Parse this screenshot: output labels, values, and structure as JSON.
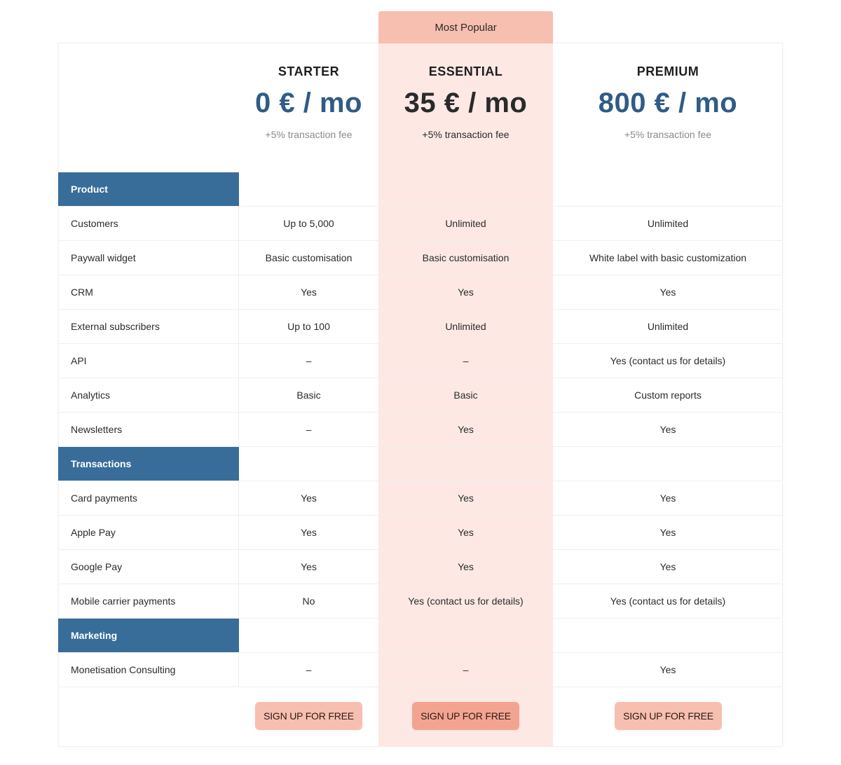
{
  "badge": {
    "label": "Most Popular"
  },
  "plans": [
    {
      "name": "STARTER",
      "price": "0 € / mo",
      "fee": "+5% transaction fee",
      "cta": "SIGN UP FOR FREE"
    },
    {
      "name": "ESSENTIAL",
      "price": "35 € / mo",
      "fee": "+5% transaction fee",
      "cta": "SIGN UP FOR FREE"
    },
    {
      "name": "PREMIUM",
      "price": "800 € / mo",
      "fee": "+5% transaction fee",
      "cta": "SIGN UP FOR FREE"
    }
  ],
  "sections": [
    {
      "title": "Product",
      "rows": [
        {
          "feature": "Customers",
          "values": [
            "Up to 5,000",
            "Unlimited",
            "Unlimited"
          ]
        },
        {
          "feature": "Paywall widget",
          "values": [
            "Basic customisation",
            "Basic customisation",
            "White label with basic customization"
          ]
        },
        {
          "feature": "CRM",
          "values": [
            "Yes",
            "Yes",
            "Yes"
          ]
        },
        {
          "feature": "External subscribers",
          "values": [
            "Up to 100",
            "Unlimited",
            "Unlimited"
          ]
        },
        {
          "feature": "API",
          "values": [
            "–",
            "–",
            "Yes (contact us for details)"
          ]
        },
        {
          "feature": "Analytics",
          "values": [
            "Basic",
            "Basic",
            "Custom reports"
          ]
        },
        {
          "feature": "Newsletters",
          "values": [
            "–",
            "Yes",
            "Yes"
          ]
        }
      ]
    },
    {
      "title": "Transactions",
      "rows": [
        {
          "feature": "Card payments",
          "values": [
            "Yes",
            "Yes",
            "Yes"
          ]
        },
        {
          "feature": "Apple Pay",
          "values": [
            "Yes",
            "Yes",
            "Yes"
          ]
        },
        {
          "feature": "Google Pay",
          "values": [
            "Yes",
            "Yes",
            "Yes"
          ]
        },
        {
          "feature": "Mobile carrier payments",
          "values": [
            "No",
            "Yes (contact us for details)",
            "Yes (contact us for details)"
          ]
        }
      ]
    },
    {
      "title": "Marketing",
      "rows": [
        {
          "feature": "Monetisation Consulting",
          "values": [
            "–",
            "–",
            "Yes"
          ]
        }
      ]
    }
  ],
  "colors": {
    "accent_blue": "#386d99",
    "price_blue": "#2f5c86",
    "highlight_bg": "#fde8e4",
    "badge_bg": "#f7bfb0",
    "button_bg": "#f7bfb0",
    "button_primary_bg": "#f3a491"
  }
}
